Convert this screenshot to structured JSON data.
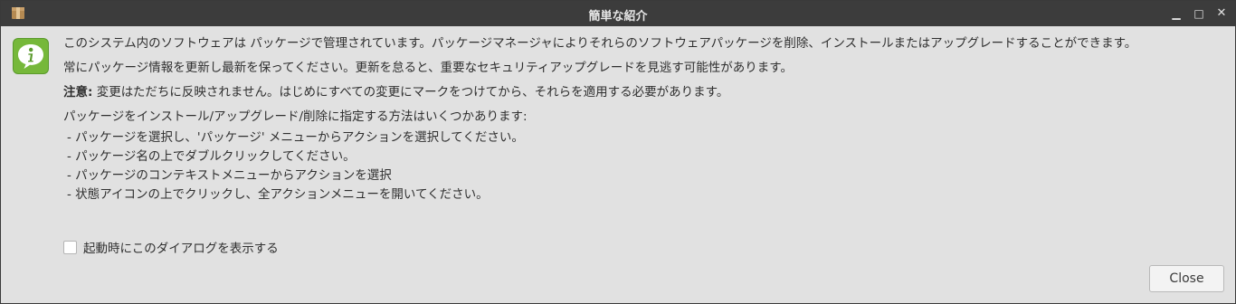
{
  "window": {
    "title": "簡単な紹介",
    "min_glyph": "▁",
    "max_glyph": "□",
    "close_glyph": "✕"
  },
  "icons": {
    "app": "package-icon",
    "info": "info-icon",
    "info_color": "#76b83a"
  },
  "content": {
    "paragraph1": "このシステム内のソフトウェアは パッケージで管理されています。パッケージマネージャによりそれらのソフトウェアパッケージを削除、インストールまたはアップグレードすることができます。",
    "paragraph2": "常にパッケージ情報を更新し最新を保ってください。更新を怠ると、重要なセキュリティアップグレードを見逃す可能性があります。",
    "note_label": "注意:",
    "note_text": " 変更はただちに反映されません。はじめにすべての変更にマークをつけてから、それらを適用する必要があります。",
    "methods_intro": "パッケージをインストール/アップグレード/削除に指定する方法はいくつかあります:",
    "methods": [
      "- パッケージを選択し、'パッケージ' メニューからアクションを選択してください。",
      "- パッケージ名の上でダブルクリックしてください。",
      "- パッケージのコンテキストメニューからアクションを選択",
      "- 状態アイコンの上でクリックし、全アクションメニューを開いてください。"
    ]
  },
  "startup_checkbox": {
    "label": "起動時にこのダイアログを表示する",
    "checked": false
  },
  "close_button": {
    "label": "Close"
  }
}
